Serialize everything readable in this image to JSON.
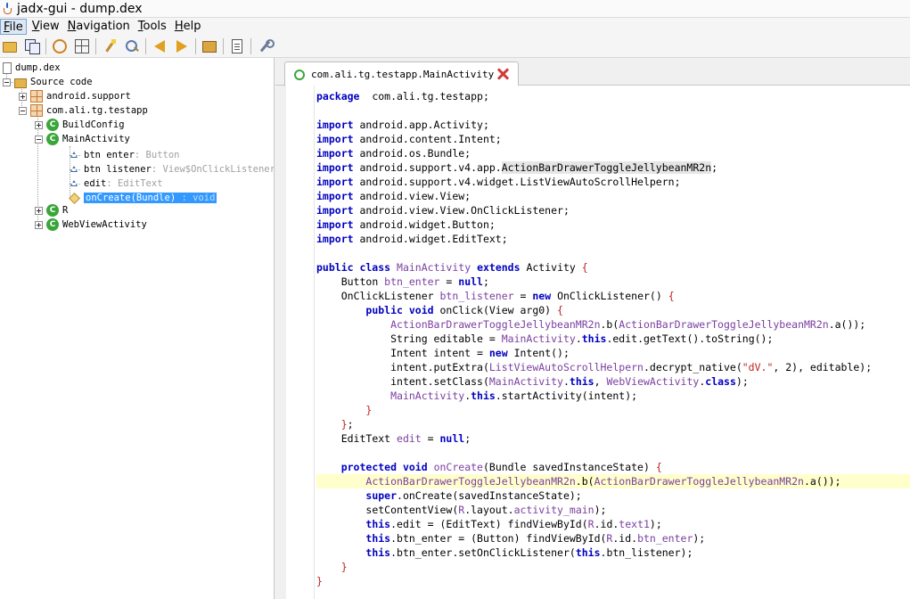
{
  "window": {
    "title": "jadx-gui - dump.dex"
  },
  "menu": [
    {
      "label": "File",
      "mnemonic": "F",
      "rest": "ile",
      "active": true
    },
    {
      "label": "View",
      "mnemonic": "V",
      "rest": "iew"
    },
    {
      "label": "Navigation",
      "mnemonic": "N",
      "rest": "avigation"
    },
    {
      "label": "Tools",
      "mnemonic": "T",
      "rest": "ools"
    },
    {
      "label": "Help",
      "mnemonic": "H",
      "rest": "elp"
    }
  ],
  "toolbar": {
    "icons": [
      "open-folder-icon",
      "copy-icon",
      "sync-icon",
      "tree-icon",
      "decompile-wand-icon",
      "search-icon",
      "back-arrow-icon",
      "forward-arrow-icon",
      "package-icon",
      "log-icon",
      "preferences-wrench-icon"
    ]
  },
  "tree": {
    "root": "dump.dex",
    "source_code": "Source code",
    "pkg_support": "android.support",
    "pkg_testapp": "com.ali.tg.testapp",
    "class_buildconfig": "BuildConfig",
    "class_main": "MainActivity",
    "field_btn_enter": "btn enter",
    "field_btn_enter_type": " : Button",
    "field_btn_listener": "btn listener",
    "field_btn_listener_type": " : View$OnClickListener",
    "field_edit": "edit",
    "field_edit_type": " : EditText",
    "method_oncreate": "onCreate(Bundle)",
    "method_oncreate_type": " : void",
    "class_r": "R",
    "class_webview": "WebViewActivity"
  },
  "tab": {
    "label": "com.ali.tg.testapp.MainActivity"
  },
  "colors": {
    "keyword": "#0000c0",
    "class_ref": "#7a3fa0",
    "string": "#c02020",
    "line_highlight": "#ffffcc",
    "selection": "#3399ff"
  },
  "code": [
    {
      "i": 0,
      "t": [
        [
          "kw",
          "package"
        ],
        [
          "",
          "  com.ali.tg.testapp;"
        ]
      ]
    },
    {
      "i": 0,
      "t": []
    },
    {
      "i": 0,
      "t": [
        [
          "kw",
          "import"
        ],
        [
          "",
          " android.app.Activity;"
        ]
      ]
    },
    {
      "i": 0,
      "t": [
        [
          "kw",
          "import"
        ],
        [
          "",
          " android.content.Intent;"
        ]
      ]
    },
    {
      "i": 0,
      "t": [
        [
          "kw",
          "import"
        ],
        [
          "",
          " android.os.Bundle;"
        ]
      ]
    },
    {
      "i": 0,
      "t": [
        [
          "kw",
          "import"
        ],
        [
          "",
          " android.support.v4.app."
        ],
        [
          "sel",
          "ActionBarDrawerToggleJellybeanMR2n"
        ],
        [
          "",
          ";"
        ]
      ]
    },
    {
      "i": 0,
      "t": [
        [
          "kw",
          "import"
        ],
        [
          "",
          " android.support.v4.widget.ListViewAutoScrollHelpern;"
        ]
      ]
    },
    {
      "i": 0,
      "t": [
        [
          "kw",
          "import"
        ],
        [
          "",
          " android.view.View;"
        ]
      ]
    },
    {
      "i": 0,
      "t": [
        [
          "kw",
          "import"
        ],
        [
          "",
          " android.view.View.OnClickListener;"
        ]
      ]
    },
    {
      "i": 0,
      "t": [
        [
          "kw",
          "import"
        ],
        [
          "",
          " android.widget.Button;"
        ]
      ]
    },
    {
      "i": 0,
      "t": [
        [
          "kw",
          "import"
        ],
        [
          "",
          " android.widget.EditText;"
        ]
      ]
    },
    {
      "i": 0,
      "t": []
    },
    {
      "i": 0,
      "t": [
        [
          "kw",
          "public class"
        ],
        [
          "",
          " "
        ],
        [
          "cls",
          "MainActivity"
        ],
        [
          "",
          " "
        ],
        [
          "kw",
          "extends"
        ],
        [
          "",
          " Activity "
        ],
        [
          "br",
          "{"
        ]
      ]
    },
    {
      "i": 1,
      "t": [
        [
          "",
          "Button "
        ],
        [
          "cls",
          "btn_enter"
        ],
        [
          "",
          " = "
        ],
        [
          "kw",
          "null"
        ],
        [
          "",
          ";"
        ]
      ]
    },
    {
      "i": 1,
      "t": [
        [
          "",
          "OnClickListener "
        ],
        [
          "cls",
          "btn_listener"
        ],
        [
          "",
          " = "
        ],
        [
          "kw",
          "new"
        ],
        [
          "",
          " OnClickListener() "
        ],
        [
          "br",
          "{"
        ]
      ]
    },
    {
      "i": 2,
      "t": [
        [
          "kw",
          "public void"
        ],
        [
          "",
          " onClick(View arg0) "
        ],
        [
          "br",
          "{"
        ]
      ]
    },
    {
      "i": 3,
      "t": [
        [
          "cls",
          "ActionBarDrawerToggleJellybeanMR2n"
        ],
        [
          "",
          ".b("
        ],
        [
          "cls",
          "ActionBarDrawerToggleJellybeanMR2n"
        ],
        [
          "",
          ".a());"
        ]
      ]
    },
    {
      "i": 3,
      "t": [
        [
          "",
          "String editable = "
        ],
        [
          "cls",
          "MainActivity"
        ],
        [
          "",
          "."
        ],
        [
          "kw",
          "this"
        ],
        [
          "",
          ".edit.getText().toString();"
        ]
      ]
    },
    {
      "i": 3,
      "t": [
        [
          "",
          "Intent intent = "
        ],
        [
          "kw",
          "new"
        ],
        [
          "",
          " Intent();"
        ]
      ]
    },
    {
      "i": 3,
      "t": [
        [
          "",
          "intent.putExtra("
        ],
        [
          "cls",
          "ListViewAutoScrollHelpern"
        ],
        [
          "",
          ".decrypt_native("
        ],
        [
          "str",
          "\"dV.\""
        ],
        [
          "",
          ", 2), editable);"
        ]
      ]
    },
    {
      "i": 3,
      "t": [
        [
          "",
          "intent.setClass("
        ],
        [
          "cls",
          "MainActivity"
        ],
        [
          "",
          "."
        ],
        [
          "kw",
          "this"
        ],
        [
          "",
          ", "
        ],
        [
          "cls",
          "WebViewActivity"
        ],
        [
          "",
          "."
        ],
        [
          "kw",
          "class"
        ],
        [
          "",
          ");"
        ]
      ]
    },
    {
      "i": 3,
      "t": [
        [
          "cls",
          "MainActivity"
        ],
        [
          "",
          "."
        ],
        [
          "kw",
          "this"
        ],
        [
          "",
          ".startActivity(intent);"
        ]
      ]
    },
    {
      "i": 2,
      "t": [
        [
          "br",
          "}"
        ]
      ]
    },
    {
      "i": 1,
      "t": [
        [
          "br",
          "}"
        ],
        [
          "",
          ";"
        ]
      ]
    },
    {
      "i": 1,
      "t": [
        [
          "",
          "EditText "
        ],
        [
          "cls",
          "edit"
        ],
        [
          "",
          " = "
        ],
        [
          "kw",
          "null"
        ],
        [
          "",
          ";"
        ]
      ]
    },
    {
      "i": 0,
      "t": []
    },
    {
      "i": 1,
      "t": [
        [
          "kw",
          "protected void"
        ],
        [
          "",
          " "
        ],
        [
          "cls",
          "onCreate"
        ],
        [
          "",
          "(Bundle savedInstanceState) "
        ],
        [
          "br",
          "{"
        ]
      ]
    },
    {
      "i": 2,
      "hl": true,
      "t": [
        [
          "cls",
          "ActionBarDrawerToggleJellybeanMR2n"
        ],
        [
          "",
          ".b("
        ],
        [
          "cls",
          "ActionBarDrawerToggleJellybeanMR2n"
        ],
        [
          "",
          ".a());"
        ]
      ]
    },
    {
      "i": 2,
      "t": [
        [
          "kw",
          "super"
        ],
        [
          "",
          ".onCreate(savedInstanceState);"
        ]
      ]
    },
    {
      "i": 2,
      "t": [
        [
          "",
          "setContentView("
        ],
        [
          "cls",
          "R"
        ],
        [
          "",
          ".layout."
        ],
        [
          "cls",
          "activity_main"
        ],
        [
          "",
          ");"
        ]
      ]
    },
    {
      "i": 2,
      "t": [
        [
          "kw",
          "this"
        ],
        [
          "",
          ".edit = (EditText) findViewById("
        ],
        [
          "cls",
          "R"
        ],
        [
          "",
          ".id."
        ],
        [
          "cls",
          "text1"
        ],
        [
          "",
          ");"
        ]
      ]
    },
    {
      "i": 2,
      "t": [
        [
          "kw",
          "this"
        ],
        [
          "",
          ".btn_enter = (Button) findViewById("
        ],
        [
          "cls",
          "R"
        ],
        [
          "",
          ".id."
        ],
        [
          "cls",
          "btn_enter"
        ],
        [
          "",
          ");"
        ]
      ]
    },
    {
      "i": 2,
      "t": [
        [
          "kw",
          "this"
        ],
        [
          "",
          ".btn_enter.setOnClickListener("
        ],
        [
          "kw",
          "this"
        ],
        [
          "",
          ".btn_listener);"
        ]
      ]
    },
    {
      "i": 1,
      "t": [
        [
          "br",
          "}"
        ]
      ]
    },
    {
      "i": 0,
      "t": [
        [
          "br",
          "}"
        ]
      ]
    }
  ]
}
